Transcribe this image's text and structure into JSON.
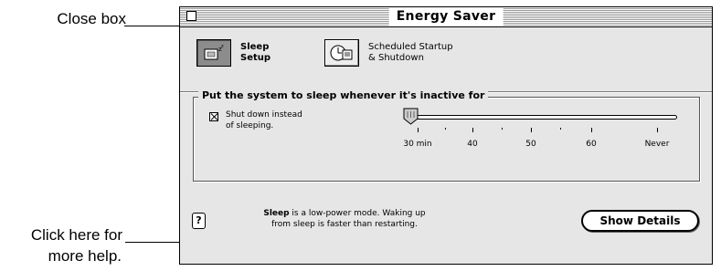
{
  "callouts": {
    "close_box": "Close box",
    "help_line1": "Click here for",
    "help_line2": "more help."
  },
  "window": {
    "title": "Energy Saver"
  },
  "modes": [
    {
      "label": "Sleep\nSetup",
      "icon": "sleep-monitor-icon",
      "selected": true
    },
    {
      "label": "Scheduled Startup\n& Shutdown",
      "icon": "clock-computer-icon",
      "selected": false
    }
  ],
  "group": {
    "label": "Put the system to sleep whenever it's inactive for",
    "checkbox_label": "Shut down instead\nof sleeping.",
    "checkbox_checked": true,
    "slider": {
      "value": "30 min",
      "tick_labels": [
        "30 min",
        "40",
        "50",
        "60",
        "Never"
      ]
    }
  },
  "footer": {
    "help_label": "?",
    "desc_bold": "Sleep",
    "desc_rest": " is a low-power mode. Waking up from sleep is faster than restarting.",
    "details_button": "Show Details"
  }
}
